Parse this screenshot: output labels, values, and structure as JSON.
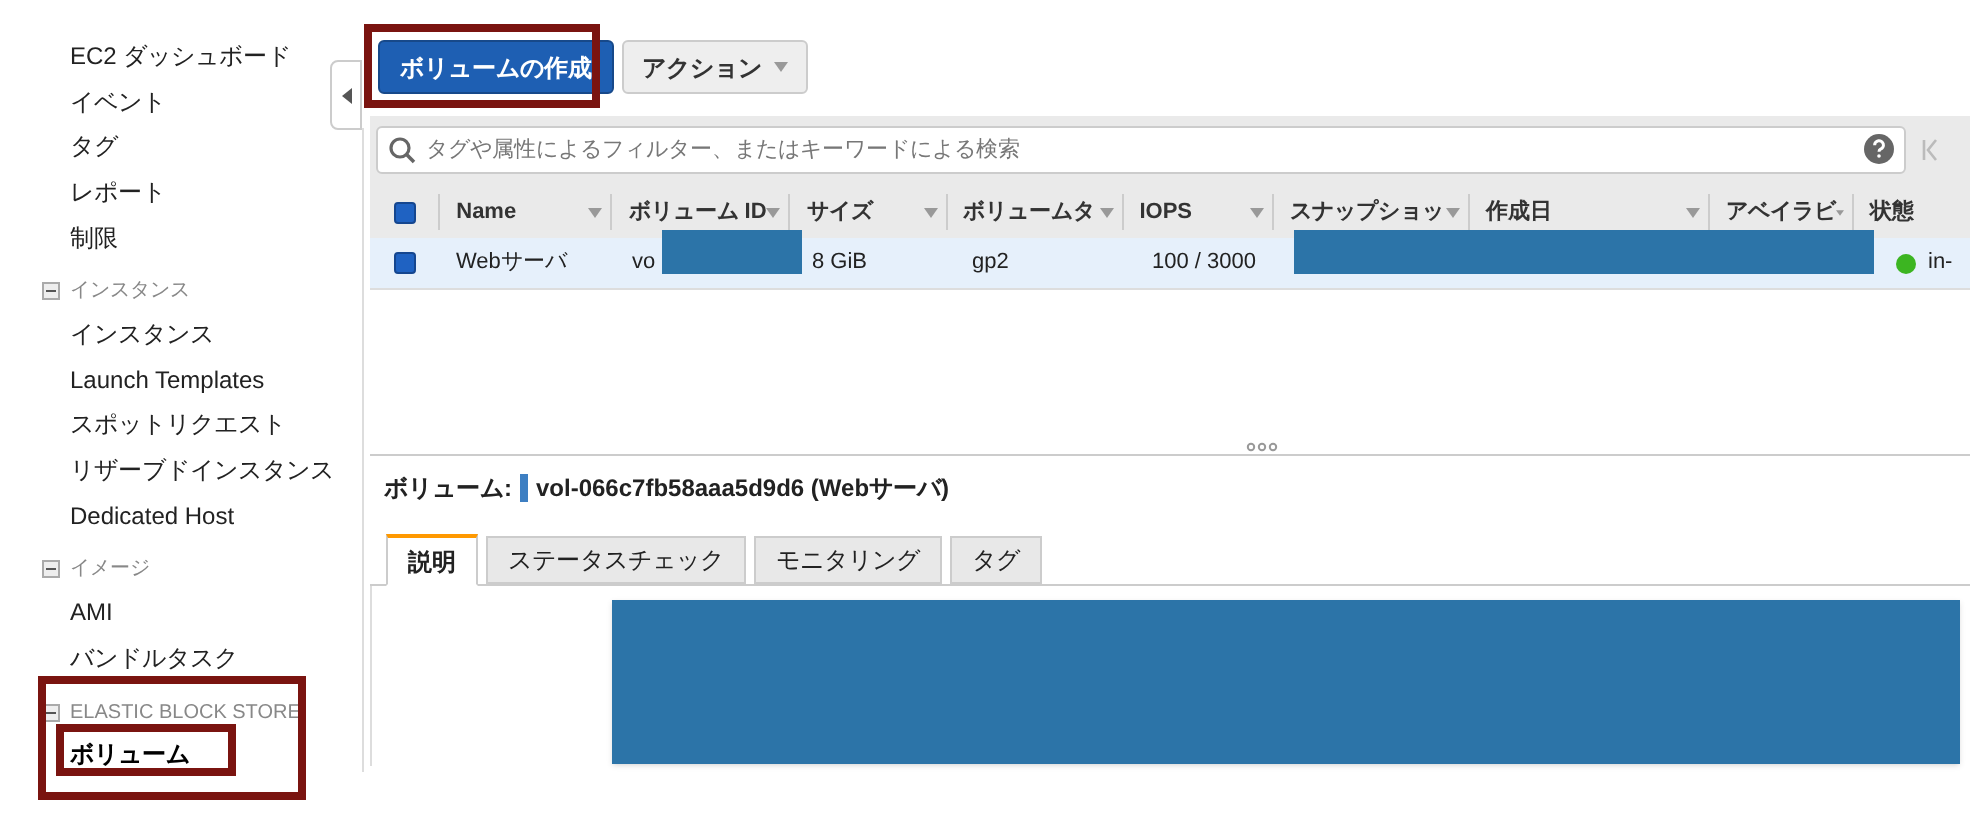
{
  "sidebar": {
    "groups": [
      {
        "items": [
          {
            "label": "EC2 ダッシュボード",
            "selected": false
          },
          {
            "label": "イベント",
            "selected": false
          },
          {
            "label": "タグ",
            "selected": false
          },
          {
            "label": "レポート",
            "selected": false
          },
          {
            "label": "制限",
            "selected": false
          }
        ]
      },
      {
        "heading": "インスタンス",
        "expanded": true,
        "items": [
          {
            "label": "インスタンス",
            "selected": false
          },
          {
            "label": "Launch Templates",
            "selected": false
          },
          {
            "label": "スポットリクエスト",
            "selected": false
          },
          {
            "label": "リザーブドインスタンス",
            "selected": false
          },
          {
            "label": "Dedicated Host",
            "selected": false
          }
        ]
      },
      {
        "heading": "イメージ",
        "expanded": true,
        "items": [
          {
            "label": "AMI",
            "selected": false
          },
          {
            "label": "バンドルタスク",
            "selected": false
          }
        ]
      },
      {
        "heading": "ELASTIC BLOCK STORE",
        "expanded": true,
        "items": [
          {
            "label": "ボリューム",
            "selected": true
          }
        ]
      }
    ]
  },
  "toolbar": {
    "buttons": [
      {
        "label": "ボリュームの作成",
        "kind": "primary"
      },
      {
        "label": "アクション",
        "kind": "dropdown"
      }
    ]
  },
  "search": {
    "placeholder": "タグや属性によるフィルター、またはキーワードによる検索"
  },
  "table": {
    "header_checked": true,
    "columns": [
      {
        "label": "Name"
      },
      {
        "label": "ボリューム ID"
      },
      {
        "label": "サイズ"
      },
      {
        "label": "ボリュームタ"
      },
      {
        "label": "IOPS"
      },
      {
        "label": "スナップショッ"
      },
      {
        "label": "作成日"
      },
      {
        "label": "アベイラビ"
      },
      {
        "label": "状態"
      }
    ],
    "rows": [
      {
        "selected": true,
        "checked": true,
        "cells": [
          "Webサーバ",
          "vo",
          "8 GiB",
          "gp2",
          "100 / 3000",
          null,
          null,
          null
        ],
        "status": "in-",
        "color": "#3cb521"
      }
    ]
  },
  "details": {
    "label": "ボリューム:",
    "value": "vol-066c7fb58aaa5d9d6 (Webサーバ)",
    "tabs": [
      {
        "label": "説明",
        "selected": true
      },
      {
        "label": "ステータスチェック",
        "selected": false
      },
      {
        "label": "モニタリング",
        "selected": false
      },
      {
        "label": "タグ",
        "selected": false
      }
    ]
  }
}
